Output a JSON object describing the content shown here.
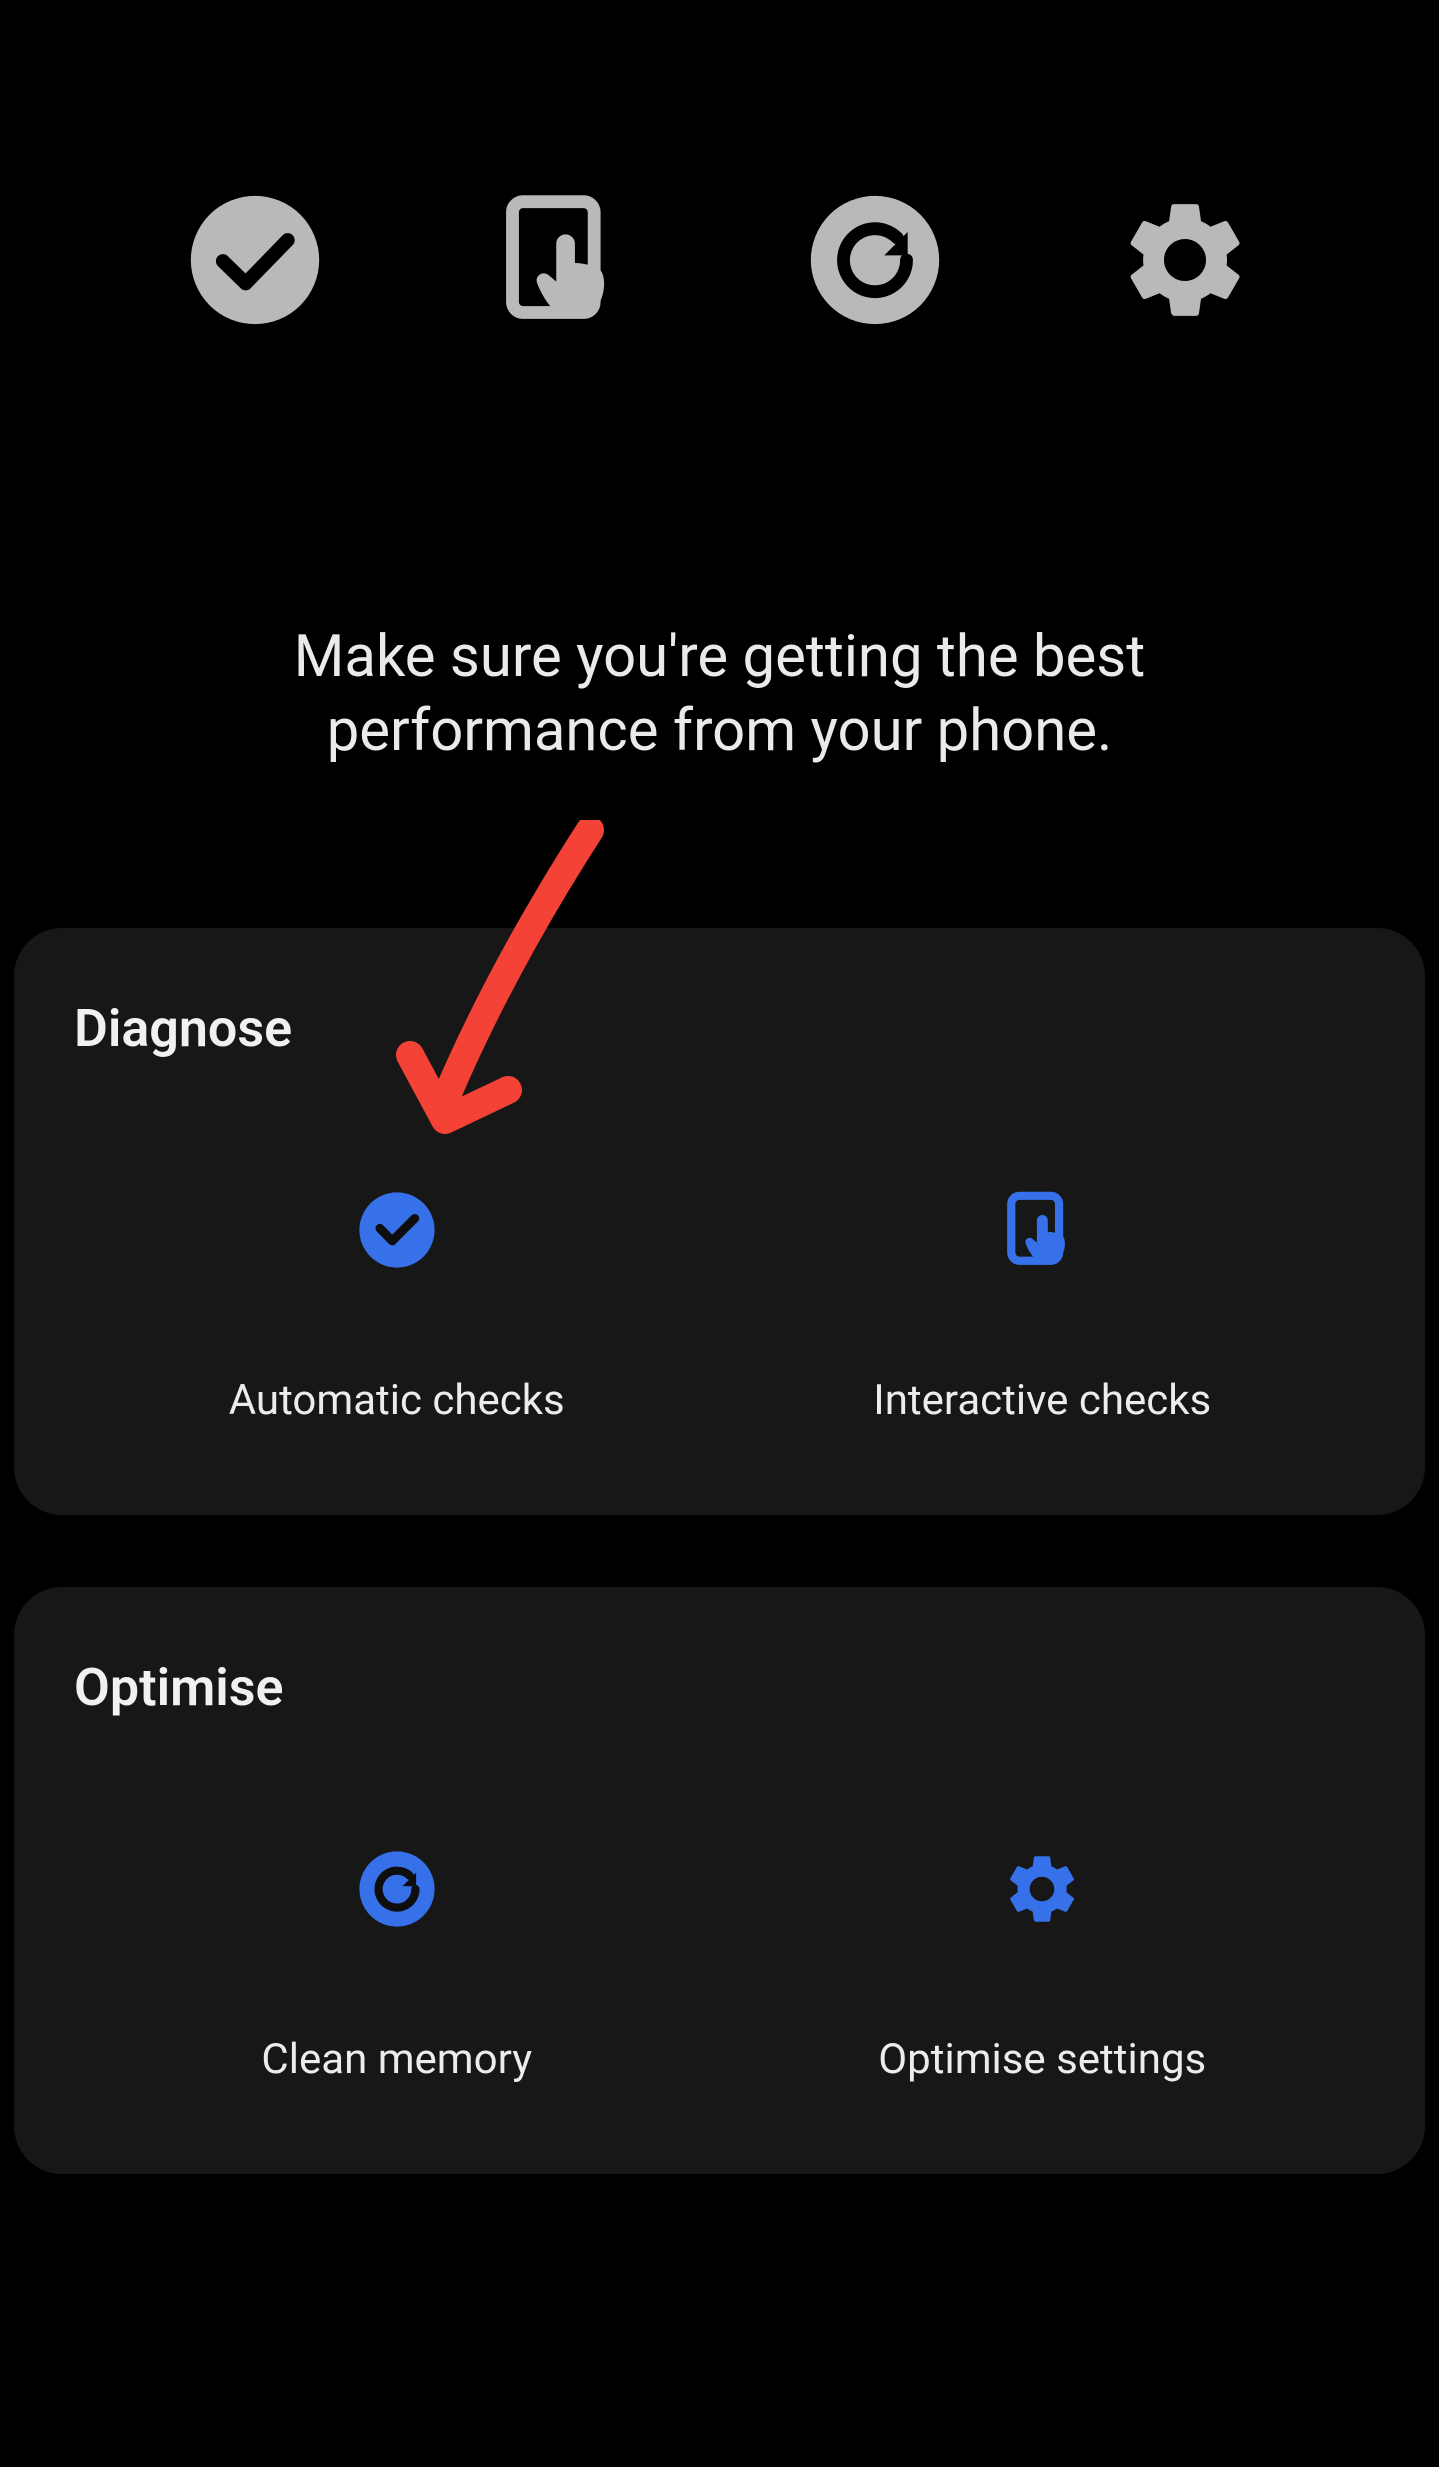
{
  "hero": {
    "line1": "Make sure you're getting the best",
    "line2": "performance from your phone."
  },
  "cards": {
    "diagnose": {
      "title": "Diagnose",
      "tiles": {
        "automatic": {
          "label": "Automatic checks"
        },
        "interactive": {
          "label": "Interactive checks"
        }
      }
    },
    "optimise": {
      "title": "Optimise",
      "tiles": {
        "clean": {
          "label": "Clean memory"
        },
        "settings": {
          "label": "Optimise settings"
        }
      }
    }
  },
  "colors": {
    "accent": "#3671ea",
    "annotation": "#f44336"
  }
}
